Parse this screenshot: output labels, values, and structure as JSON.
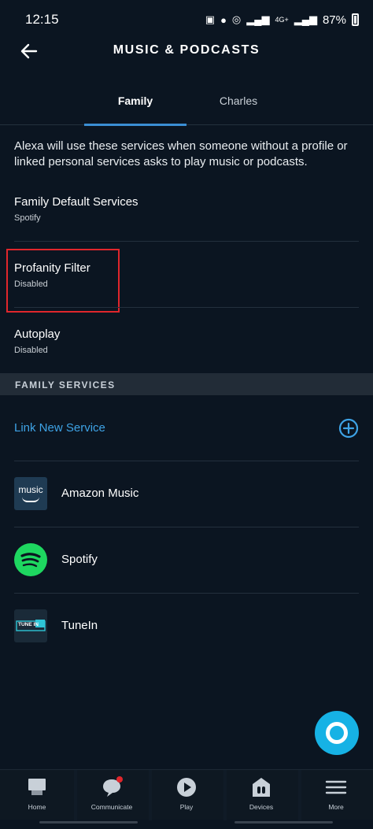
{
  "status": {
    "time": "12:15",
    "network": "4G+",
    "battery": "87%"
  },
  "header": {
    "title": "MUSIC & PODCASTS",
    "back_icon": "arrow-left-icon"
  },
  "tabs": [
    {
      "label": "Family",
      "active": true
    },
    {
      "label": "Charles",
      "active": false
    }
  ],
  "intro": "Alexa will use these services when someone without a profile or linked personal services asks to play music or podcasts.",
  "settings": [
    {
      "title": "Family Default Services",
      "value": "Spotify"
    },
    {
      "title": "Profanity Filter",
      "value": "Disabled"
    },
    {
      "title": "Autoplay",
      "value": "Disabled"
    }
  ],
  "section": {
    "title": "FAMILY SERVICES"
  },
  "link_service": {
    "label": "Link New Service",
    "icon": "plus-circle-icon"
  },
  "services": [
    {
      "name": "Amazon Music",
      "logo_text": "music"
    },
    {
      "name": "Spotify"
    },
    {
      "name": "TuneIn",
      "logo_text": "TUNE IN"
    }
  ],
  "nav": [
    {
      "label": "Home",
      "icon": "home-icon"
    },
    {
      "label": "Communicate",
      "icon": "chat-icon"
    },
    {
      "label": "Play",
      "icon": "play-icon"
    },
    {
      "label": "Devices",
      "icon": "devices-icon"
    },
    {
      "label": "More",
      "icon": "menu-icon"
    }
  ],
  "colors": {
    "background": "#0b1521",
    "accent": "#3ea3e6",
    "alexa": "#16b2e5",
    "highlight": "#e0262c",
    "spotify": "#1ed760"
  }
}
